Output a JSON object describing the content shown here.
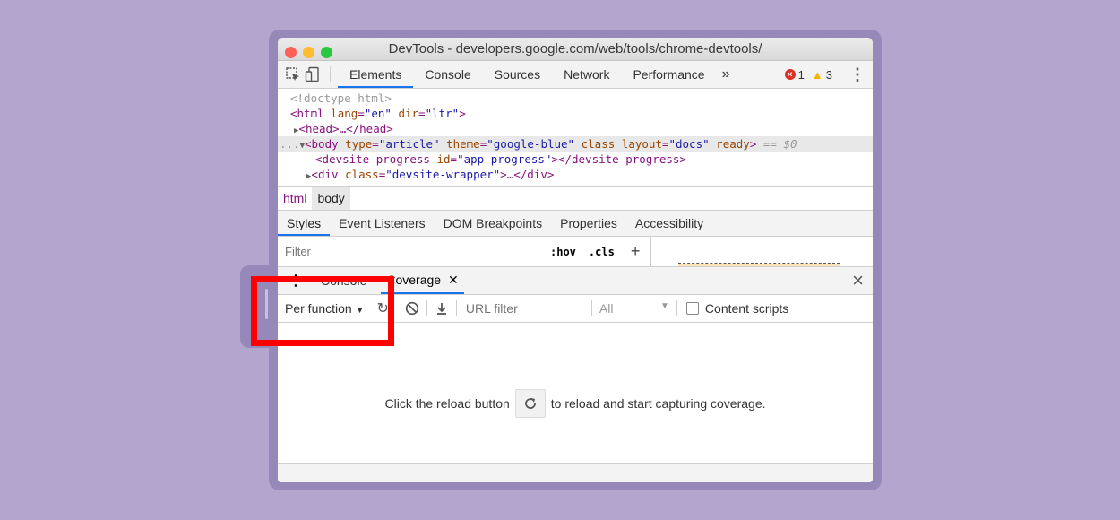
{
  "window": {
    "title": "DevTools - developers.google.com/web/tools/chrome-devtools/"
  },
  "toolbar": {
    "tabs": [
      "Elements",
      "Console",
      "Sources",
      "Network",
      "Performance"
    ],
    "more": "»",
    "errors": "1",
    "warnings": "3"
  },
  "dom": {
    "doctype": "<!doctype html>",
    "html_open": "<html",
    "html_lang_attr": "lang",
    "html_lang_val": "\"en\"",
    "html_dir_attr": "dir",
    "html_dir_val": "\"ltr\"",
    "head": "<head>…</head>",
    "body_dots": "...",
    "body_tag": "<body",
    "body_type_attr": "type",
    "body_type_val": "\"article\"",
    "body_theme_attr": "theme",
    "body_theme_val": "\"google-blue\"",
    "body_class_attr": "class",
    "body_layout_attr": "layout",
    "body_layout_val": "\"docs\"",
    "body_ready_attr": "ready",
    "body_eq": "== $0",
    "progress_open": "<devsite-progress",
    "progress_id_attr": "id",
    "progress_id_val": "\"app-progress\"",
    "progress_close": "></devsite-progress>",
    "div_open": "<div",
    "div_class_attr": "class",
    "div_class_val": "\"devsite-wrapper\"",
    "div_close": ">…</div>"
  },
  "breadcrumbs": [
    "html",
    "body"
  ],
  "subtabs": [
    "Styles",
    "Event Listeners",
    "DOM Breakpoints",
    "Properties",
    "Accessibility"
  ],
  "styles": {
    "filter_placeholder": "Filter",
    "hov": ":hov",
    "cls": ".cls",
    "add": "+"
  },
  "drawer": {
    "console_tab": "Console",
    "coverage_tab": "Coverage",
    "close": "×"
  },
  "coverage": {
    "mode": "Per function",
    "url_filter_placeholder": "URL filter",
    "type_filter": "All",
    "content_scripts": "Content scripts",
    "message_before": "Click the reload button",
    "message_after": "to reload and start capturing coverage."
  },
  "colors": {
    "accent": "#1a73e8",
    "highlight": "#ff0000",
    "background": "#b4a5cf"
  }
}
